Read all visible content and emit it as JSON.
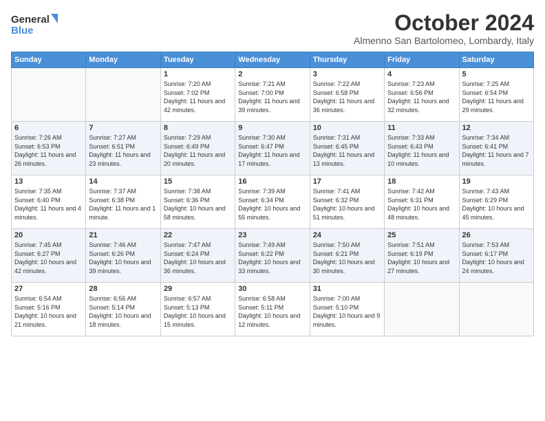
{
  "logo": {
    "line1": "General",
    "line2": "Blue"
  },
  "title": "October 2024",
  "location": "Almenno San Bartolomeo, Lombardy, Italy",
  "days_of_week": [
    "Sunday",
    "Monday",
    "Tuesday",
    "Wednesday",
    "Thursday",
    "Friday",
    "Saturday"
  ],
  "weeks": [
    [
      {
        "day": "",
        "content": ""
      },
      {
        "day": "",
        "content": ""
      },
      {
        "day": "1",
        "content": "Sunrise: 7:20 AM\nSunset: 7:02 PM\nDaylight: 11 hours and 42 minutes."
      },
      {
        "day": "2",
        "content": "Sunrise: 7:21 AM\nSunset: 7:00 PM\nDaylight: 11 hours and 39 minutes."
      },
      {
        "day": "3",
        "content": "Sunrise: 7:22 AM\nSunset: 6:58 PM\nDaylight: 11 hours and 36 minutes."
      },
      {
        "day": "4",
        "content": "Sunrise: 7:23 AM\nSunset: 6:56 PM\nDaylight: 11 hours and 32 minutes."
      },
      {
        "day": "5",
        "content": "Sunrise: 7:25 AM\nSunset: 6:54 PM\nDaylight: 11 hours and 29 minutes."
      }
    ],
    [
      {
        "day": "6",
        "content": "Sunrise: 7:26 AM\nSunset: 6:53 PM\nDaylight: 11 hours and 26 minutes."
      },
      {
        "day": "7",
        "content": "Sunrise: 7:27 AM\nSunset: 6:51 PM\nDaylight: 11 hours and 23 minutes."
      },
      {
        "day": "8",
        "content": "Sunrise: 7:29 AM\nSunset: 6:49 PM\nDaylight: 11 hours and 20 minutes."
      },
      {
        "day": "9",
        "content": "Sunrise: 7:30 AM\nSunset: 6:47 PM\nDaylight: 11 hours and 17 minutes."
      },
      {
        "day": "10",
        "content": "Sunrise: 7:31 AM\nSunset: 6:45 PM\nDaylight: 11 hours and 13 minutes."
      },
      {
        "day": "11",
        "content": "Sunrise: 7:33 AM\nSunset: 6:43 PM\nDaylight: 11 hours and 10 minutes."
      },
      {
        "day": "12",
        "content": "Sunrise: 7:34 AM\nSunset: 6:41 PM\nDaylight: 11 hours and 7 minutes."
      }
    ],
    [
      {
        "day": "13",
        "content": "Sunrise: 7:35 AM\nSunset: 6:40 PM\nDaylight: 11 hours and 4 minutes."
      },
      {
        "day": "14",
        "content": "Sunrise: 7:37 AM\nSunset: 6:38 PM\nDaylight: 11 hours and 1 minute."
      },
      {
        "day": "15",
        "content": "Sunrise: 7:38 AM\nSunset: 6:36 PM\nDaylight: 10 hours and 58 minutes."
      },
      {
        "day": "16",
        "content": "Sunrise: 7:39 AM\nSunset: 6:34 PM\nDaylight: 10 hours and 55 minutes."
      },
      {
        "day": "17",
        "content": "Sunrise: 7:41 AM\nSunset: 6:32 PM\nDaylight: 10 hours and 51 minutes."
      },
      {
        "day": "18",
        "content": "Sunrise: 7:42 AM\nSunset: 6:31 PM\nDaylight: 10 hours and 48 minutes."
      },
      {
        "day": "19",
        "content": "Sunrise: 7:43 AM\nSunset: 6:29 PM\nDaylight: 10 hours and 45 minutes."
      }
    ],
    [
      {
        "day": "20",
        "content": "Sunrise: 7:45 AM\nSunset: 6:27 PM\nDaylight: 10 hours and 42 minutes."
      },
      {
        "day": "21",
        "content": "Sunrise: 7:46 AM\nSunset: 6:26 PM\nDaylight: 10 hours and 39 minutes."
      },
      {
        "day": "22",
        "content": "Sunrise: 7:47 AM\nSunset: 6:24 PM\nDaylight: 10 hours and 36 minutes."
      },
      {
        "day": "23",
        "content": "Sunrise: 7:49 AM\nSunset: 6:22 PM\nDaylight: 10 hours and 33 minutes."
      },
      {
        "day": "24",
        "content": "Sunrise: 7:50 AM\nSunset: 6:21 PM\nDaylight: 10 hours and 30 minutes."
      },
      {
        "day": "25",
        "content": "Sunrise: 7:51 AM\nSunset: 6:19 PM\nDaylight: 10 hours and 27 minutes."
      },
      {
        "day": "26",
        "content": "Sunrise: 7:53 AM\nSunset: 6:17 PM\nDaylight: 10 hours and 24 minutes."
      }
    ],
    [
      {
        "day": "27",
        "content": "Sunrise: 6:54 AM\nSunset: 5:16 PM\nDaylight: 10 hours and 21 minutes."
      },
      {
        "day": "28",
        "content": "Sunrise: 6:56 AM\nSunset: 5:14 PM\nDaylight: 10 hours and 18 minutes."
      },
      {
        "day": "29",
        "content": "Sunrise: 6:57 AM\nSunset: 5:13 PM\nDaylight: 10 hours and 15 minutes."
      },
      {
        "day": "30",
        "content": "Sunrise: 6:58 AM\nSunset: 5:11 PM\nDaylight: 10 hours and 12 minutes."
      },
      {
        "day": "31",
        "content": "Sunrise: 7:00 AM\nSunset: 5:10 PM\nDaylight: 10 hours and 9 minutes."
      },
      {
        "day": "",
        "content": ""
      },
      {
        "day": "",
        "content": ""
      }
    ]
  ]
}
